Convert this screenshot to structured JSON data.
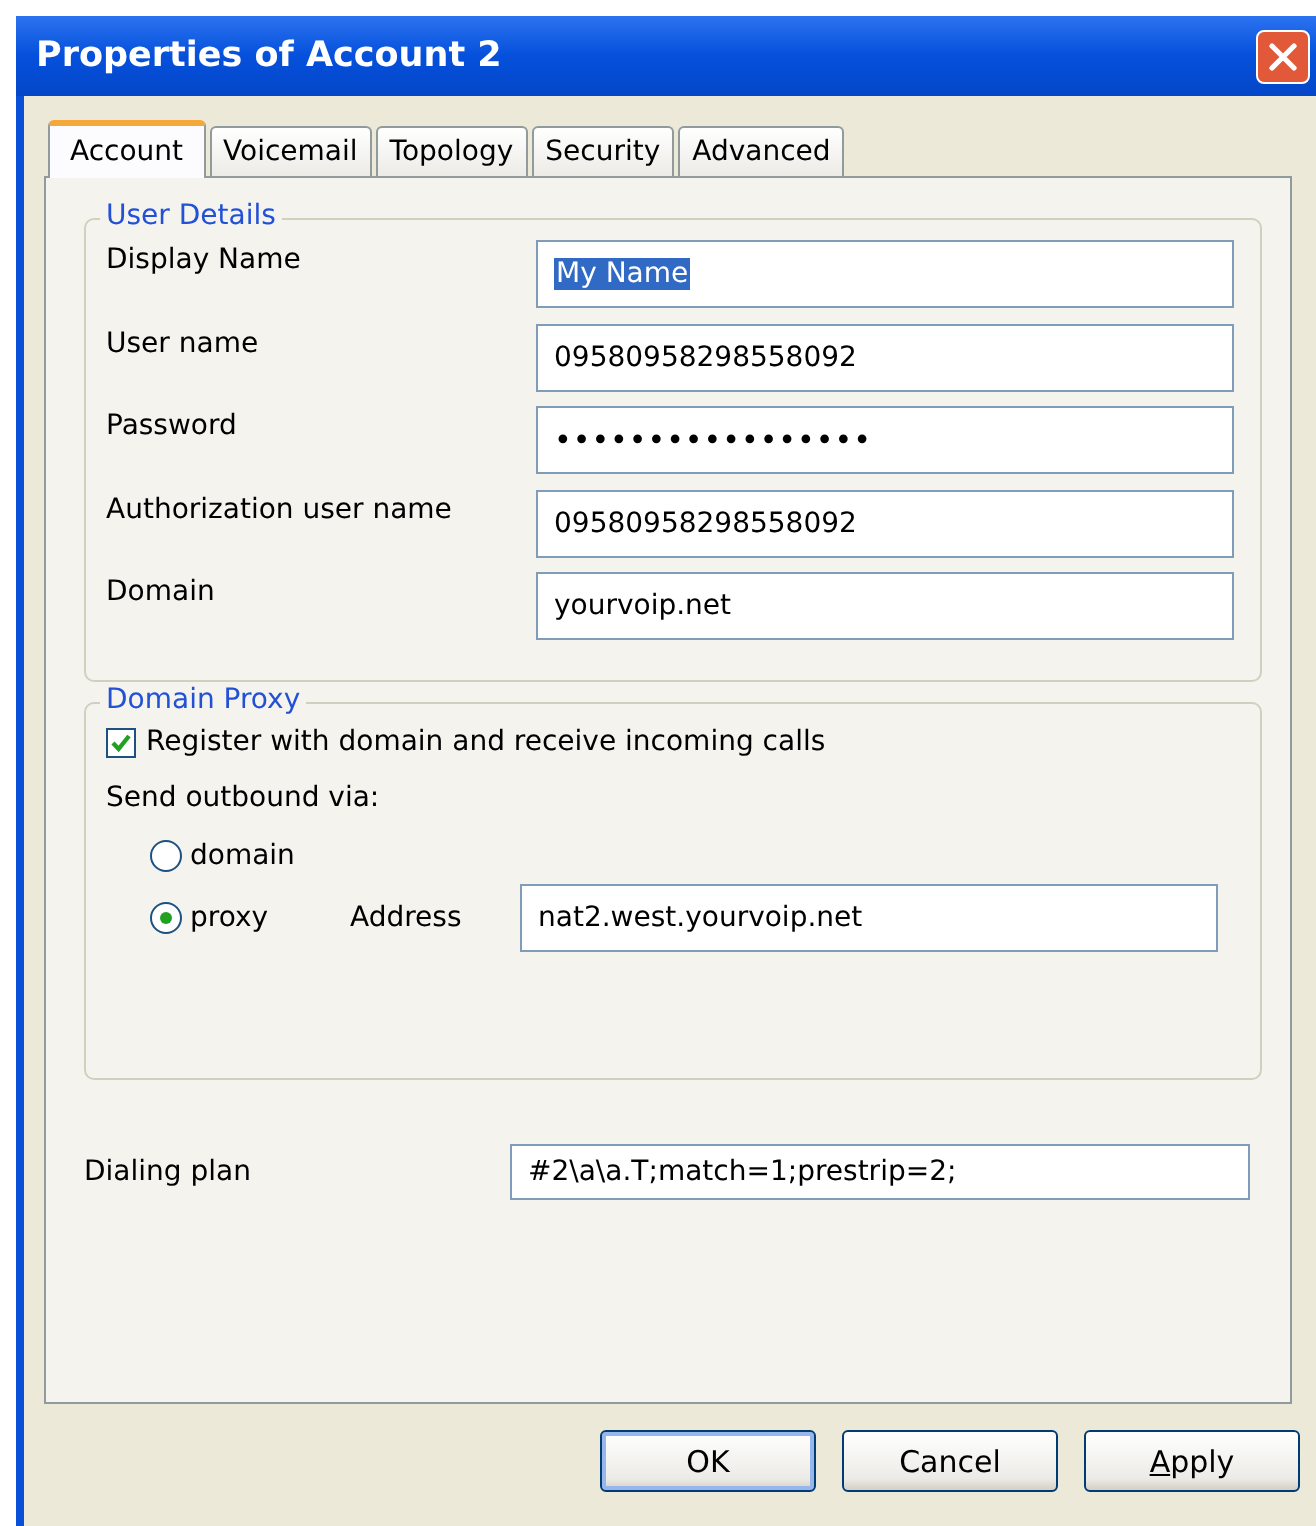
{
  "window": {
    "title": "Properties of Account 2"
  },
  "tabs": [
    {
      "label": "Account",
      "selected": true
    },
    {
      "label": "Voicemail",
      "selected": false
    },
    {
      "label": "Topology",
      "selected": false
    },
    {
      "label": "Security",
      "selected": false
    },
    {
      "label": "Advanced",
      "selected": false
    }
  ],
  "user_details": {
    "title": "User Details",
    "fields": [
      {
        "label": "Display Name",
        "value": "My Name",
        "selected": true
      },
      {
        "label": "User name",
        "value": "09580958298558092",
        "selected": false
      },
      {
        "label": "Password",
        "value": "•••••••••••••••••",
        "selected": false
      },
      {
        "label": "Authorization user name",
        "value": "09580958298558092",
        "selected": false
      },
      {
        "label": "Domain",
        "value": "yourvoip.net",
        "selected": false
      }
    ]
  },
  "domain_proxy": {
    "title": "Domain Proxy",
    "register": {
      "label": "Register with domain and receive incoming calls",
      "checked": true
    },
    "send_label": "Send outbound via:",
    "options": [
      {
        "label": "domain",
        "selected": false
      },
      {
        "label": "proxy",
        "selected": true
      }
    ],
    "address": {
      "label": "Address",
      "value": "nat2.west.yourvoip.net"
    }
  },
  "dialing_plan": {
    "label": "Dialing plan",
    "value": "#2\\a\\a.T;match=1;prestrip=2;"
  },
  "buttons": [
    {
      "label": "OK",
      "default": true,
      "underline_first": false
    },
    {
      "label": "Cancel",
      "default": false,
      "underline_first": false
    },
    {
      "label": "Apply",
      "default": false,
      "underline_first": true
    }
  ]
}
